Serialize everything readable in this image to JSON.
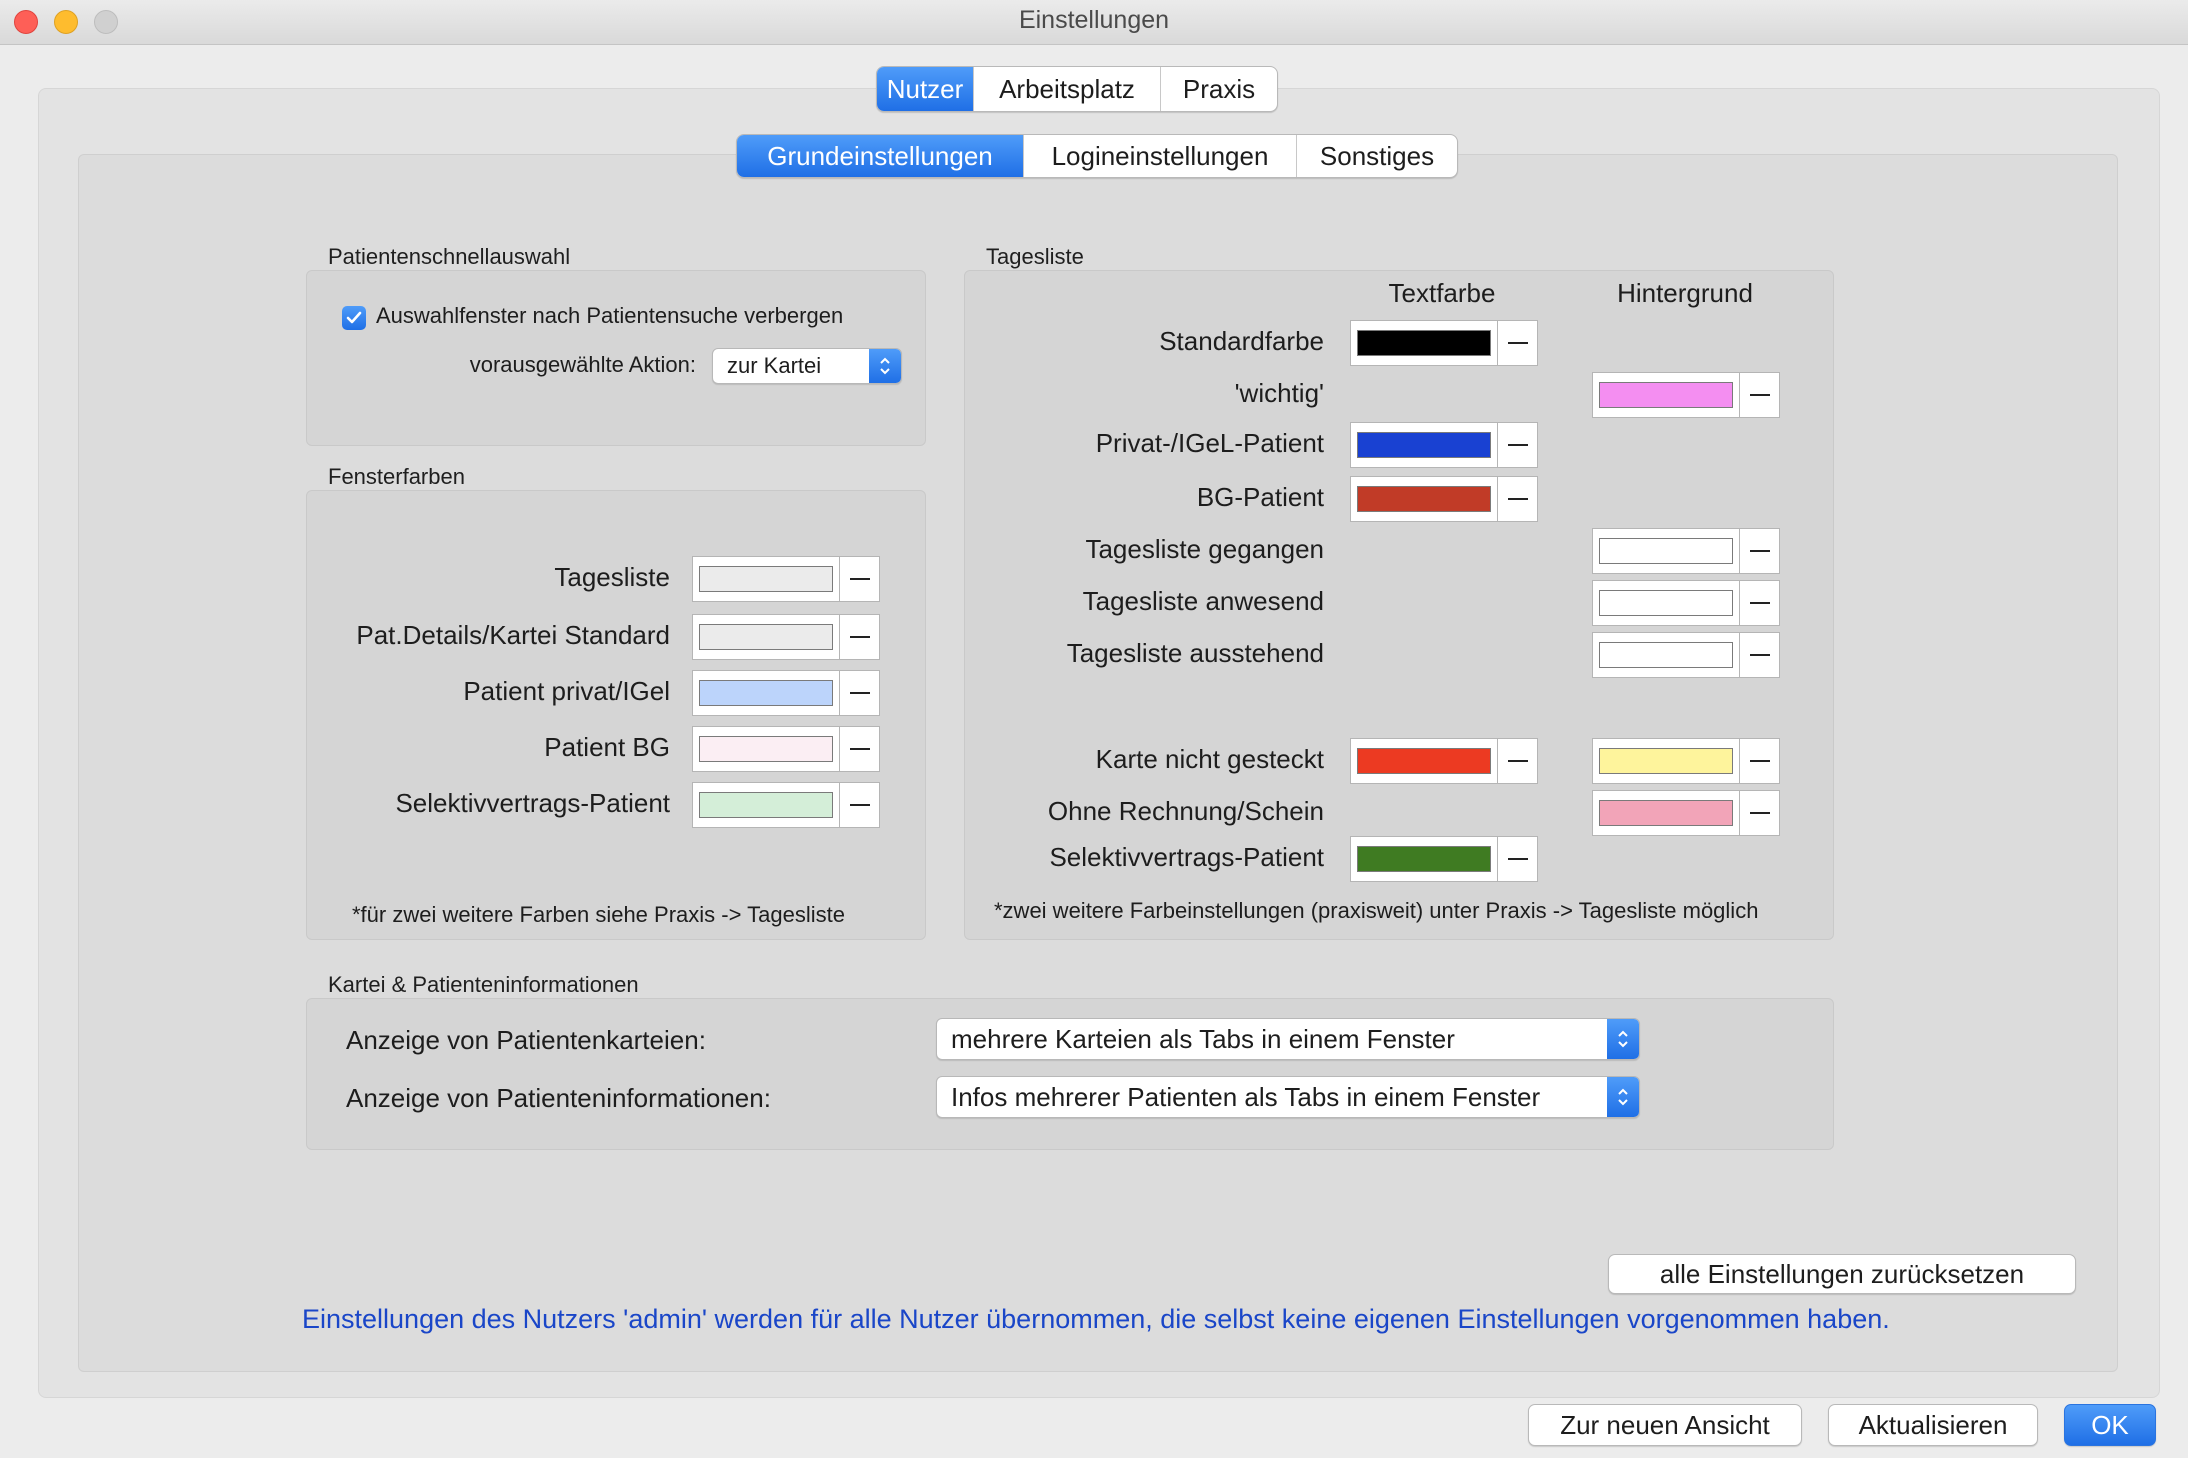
{
  "window": {
    "title": "Einstellungen"
  },
  "colors": {
    "accent": "#1f6fe6",
    "info_text": "#1a46c8"
  },
  "top_tabs": [
    {
      "label": "Nutzer",
      "active": true
    },
    {
      "label": "Arbeitsplatz",
      "active": false
    },
    {
      "label": "Praxis",
      "active": false
    }
  ],
  "sub_tabs": [
    {
      "label": "Grundeinstellungen",
      "active": true
    },
    {
      "label": "Logineinstellungen",
      "active": false
    },
    {
      "label": "Sonstiges",
      "active": false
    }
  ],
  "schnellauswahl": {
    "title": "Patientenschnellauswahl",
    "checkbox_label": "Auswahlfenster nach Patientensuche verbergen",
    "checked": true,
    "action_label": "vorausgewählte Aktion:",
    "action_value": "zur Kartei"
  },
  "fensterfarben": {
    "title": "Fensterfarben",
    "rows": [
      {
        "label": "Tagesliste",
        "color": "#ebebeb"
      },
      {
        "label": "Pat.Details/Kartei Standard",
        "color": "#ebebeb"
      },
      {
        "label": "Patient privat/IGel",
        "color": "#bcd4fb"
      },
      {
        "label": "Patient BG",
        "color": "#fbeef3"
      },
      {
        "label": "Selektivvertrags-Patient",
        "color": "#d4eed8"
      }
    ],
    "note": "*für zwei weitere Farben siehe Praxis -> Tagesliste"
  },
  "tagesliste": {
    "title": "Tagesliste",
    "col_text": "Textfarbe",
    "col_bg": "Hintergrund",
    "rows": [
      {
        "label": "Standardfarbe",
        "text_color": "#000000",
        "bg_color": null
      },
      {
        "label": "'wichtig'",
        "text_color": null,
        "bg_color": "#f48ef1"
      },
      {
        "label": "Privat-/IGeL-Patient",
        "text_color": "#1941d2",
        "bg_color": null
      },
      {
        "label": "BG-Patient",
        "text_color": "#c13b27",
        "bg_color": null
      },
      {
        "label": "Tagesliste gegangen",
        "text_color": null,
        "bg_color": "#ffffff"
      },
      {
        "label": "Tagesliste anwesend",
        "text_color": null,
        "bg_color": "#ffffff"
      },
      {
        "label": "Tagesliste ausstehend",
        "text_color": null,
        "bg_color": "#ffffff"
      },
      {
        "label": "Karte nicht gesteckt",
        "text_color": "#ec3a22",
        "bg_color": "#fef49c"
      },
      {
        "label": "Ohne Rechnung/Schein",
        "text_color": null,
        "bg_color": "#f2a4b8"
      },
      {
        "label": "Selektivvertrags-Patient",
        "text_color": "#3f7b22",
        "bg_color": null
      }
    ],
    "note": "*zwei weitere Farbeinstellungen (praxisweit) unter Praxis -> Tagesliste möglich"
  },
  "kartei": {
    "title": "Kartei & Patienteninformationen",
    "rows": [
      {
        "label": "Anzeige von Patientenkarteien:",
        "value": "mehrere Karteien als Tabs in einem Fenster"
      },
      {
        "label": "Anzeige von Patienteninformationen:",
        "value": "Infos mehrerer Patienten als Tabs in einem Fenster"
      }
    ]
  },
  "reset_button": "alle Einstellungen zurücksetzen",
  "info_text": "Einstellungen des Nutzers 'admin' werden für alle Nutzer übernommen, die selbst keine eigenen Einstellungen vorgenommen haben.",
  "footer": {
    "new_view": "Zur neuen Ansicht",
    "refresh": "Aktualisieren",
    "ok": "OK"
  }
}
